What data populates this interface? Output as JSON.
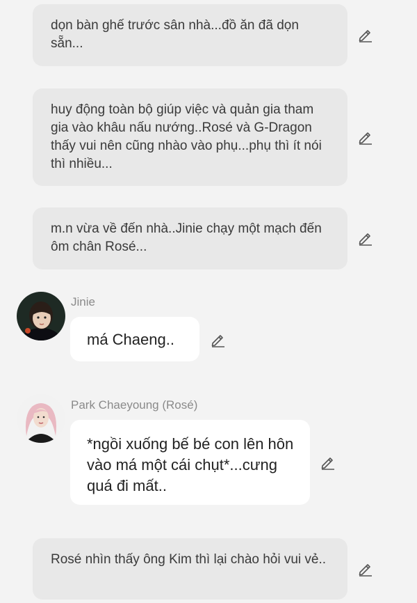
{
  "messages": [
    {
      "type": "narration",
      "text": "dọn bàn ghế trước sân nhà...đồ ăn đã dọn sẵn..."
    },
    {
      "type": "narration",
      "text": "huy động toàn bộ giúp việc và quản gia tham gia vào khâu nấu nướng..Rosé và G-Dragon thấy vui nên cũng nhào vào phụ...phụ thì ít nói thì nhiều..."
    },
    {
      "type": "narration",
      "text": "m.n vừa về đến nhà..Jinie chạy một mạch đến ôm chân Rosé..."
    },
    {
      "type": "dialogue",
      "speaker": "Jinie",
      "text": "má Chaeng.."
    },
    {
      "type": "dialogue",
      "speaker": "Park Chaeyoung (Rosé)",
      "text": "*ngồi xuống bế bé con lên hôn vào má một cái chụt*...cưng quá đi mất.."
    },
    {
      "type": "narration",
      "text": "Rosé nhìn thấy ông Kim thì lại chào hỏi vui vẻ.."
    }
  ],
  "icons": {
    "edit": "pencil-edit-icon"
  },
  "colors": {
    "background": "#f3f3f3",
    "narration_bubble": "#e8e8e8",
    "dialogue_bubble": "#ffffff",
    "speaker_name": "#8a8a8a"
  }
}
